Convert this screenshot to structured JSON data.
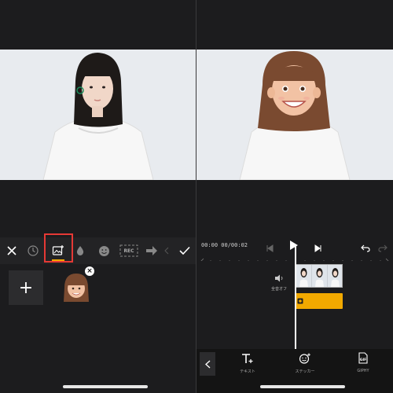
{
  "left_editor": {
    "toolbar": {
      "close_icon": "close-icon",
      "history_icon": "clock-icon",
      "image_add_icon": "image-add-icon",
      "drop_icon": "drop-icon",
      "emoji_icon": "emoji-icon",
      "rec_label": "REC",
      "arrow_icon": "arrow-right-icon",
      "confirm_icon": "check-icon"
    },
    "add_tile_label": "+",
    "sticker_close_label": "×",
    "highlight_color": "#e53935",
    "accent_color": "#f2a900"
  },
  "right_editor": {
    "timecode": "00:00 00/00:02",
    "volume_label": "全音オフ",
    "tools": [
      {
        "label": "テキスト",
        "icon": "text-add-icon"
      },
      {
        "label": "ステッカー",
        "icon": "sticker-add-icon"
      },
      {
        "label": "GIPHY",
        "icon": "gif-icon"
      }
    ],
    "track_color": "#f2a900"
  }
}
